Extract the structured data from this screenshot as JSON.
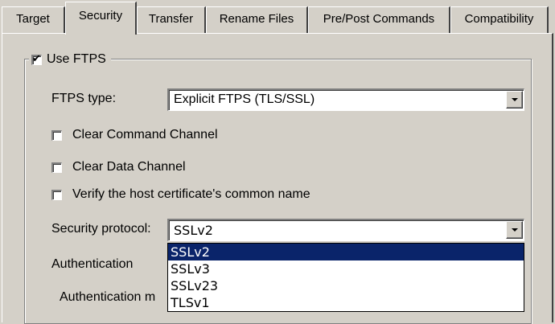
{
  "tabs": [
    {
      "label": "Target"
    },
    {
      "label": "Security"
    },
    {
      "label": "Transfer"
    },
    {
      "label": "Rename Files"
    },
    {
      "label": "Pre/Post Commands"
    },
    {
      "label": "Compatibility"
    }
  ],
  "use_ftps": {
    "label": "Use FTPS",
    "checked": true
  },
  "ftps_type": {
    "label": "FTPS type:",
    "value": "Explicit FTPS (TLS/SSL)"
  },
  "options": [
    {
      "label": "Clear Command Channel",
      "checked": false
    },
    {
      "label": "Clear Data Channel",
      "checked": false
    },
    {
      "label": "Verify the host certificate's common name",
      "checked": false
    }
  ],
  "security_protocol": {
    "label": "Security protocol:",
    "value": "SSLv2",
    "options": [
      "SSLv2",
      "SSLv3",
      "SSLv23",
      "TLSv1"
    ],
    "highlighted": "SSLv2"
  },
  "authentication": {
    "label": "Authentication",
    "method_label": "Authentication m"
  },
  "colors": {
    "face": "#d4d0c8",
    "selection": "#0a246a"
  }
}
